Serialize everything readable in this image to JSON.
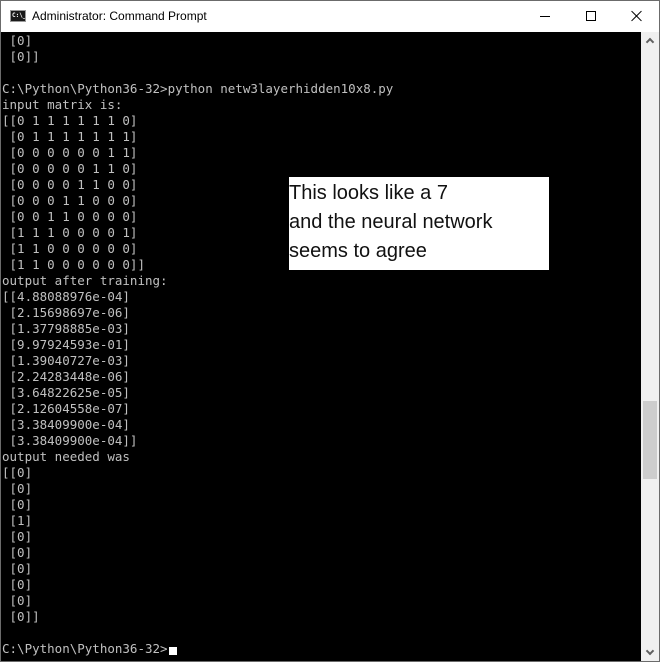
{
  "window": {
    "title": "Administrator: Command Prompt",
    "app_icon": "cmd-icon",
    "app_icon_text": "C:\\_",
    "controls": {
      "minimize": "minimize-icon",
      "maximize": "maximize-icon",
      "close": "close-icon"
    }
  },
  "console": {
    "lines": [
      " [0]",
      " [0]]",
      "",
      "C:\\Python\\Python36-32>python netw3layerhidden10x8.py",
      "input matrix is:",
      "[[0 1 1 1 1 1 1 0]",
      " [0 1 1 1 1 1 1 1]",
      " [0 0 0 0 0 0 1 1]",
      " [0 0 0 0 0 1 1 0]",
      " [0 0 0 0 1 1 0 0]",
      " [0 0 0 1 1 0 0 0]",
      " [0 0 1 1 0 0 0 0]",
      " [1 1 1 0 0 0 0 1]",
      " [1 1 0 0 0 0 0 0]",
      " [1 1 0 0 0 0 0 0]]",
      "output after training:",
      "[[4.88088976e-04]",
      " [2.15698697e-06]",
      " [1.37798885e-03]",
      " [9.97924593e-01]",
      " [1.39040727e-03]",
      " [2.24283448e-06]",
      " [3.64822625e-05]",
      " [2.12604558e-07]",
      " [3.38409900e-04]",
      " [3.38409900e-04]]",
      "output needed was",
      "[[0]",
      " [0]",
      " [0]",
      " [1]",
      " [0]",
      " [0]",
      " [0]",
      " [0]",
      " [0]",
      " [0]]",
      "",
      "C:\\Python\\Python36-32>"
    ],
    "prompt_cursor": true,
    "colors": {
      "background": "#000000",
      "foreground": "#c0c0c0"
    }
  },
  "annotation": {
    "lines": [
      "This looks like a 7",
      "and the neural network",
      "seems to agree"
    ]
  },
  "scrollbar": {
    "up_icon": "chevron-up-icon",
    "down_icon": "chevron-down-icon"
  }
}
